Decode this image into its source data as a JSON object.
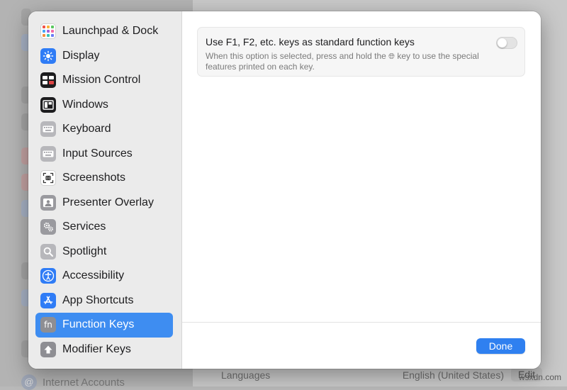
{
  "background": {
    "languages_label": "Languages",
    "languages_value": "English (United States)",
    "edit_label": "Edit",
    "internet_accounts_label": "Internet Accounts"
  },
  "sidebar": {
    "items": [
      {
        "label": "Launchpad & Dock",
        "icon": "launchpad-icon"
      },
      {
        "label": "Display",
        "icon": "display-brightness-icon"
      },
      {
        "label": "Mission Control",
        "icon": "mission-control-icon"
      },
      {
        "label": "Windows",
        "icon": "windows-icon"
      },
      {
        "label": "Keyboard",
        "icon": "keyboard-icon"
      },
      {
        "label": "Input Sources",
        "icon": "input-sources-icon"
      },
      {
        "label": "Screenshots",
        "icon": "screenshot-icon"
      },
      {
        "label": "Presenter Overlay",
        "icon": "presenter-overlay-icon"
      },
      {
        "label": "Services",
        "icon": "gears-icon"
      },
      {
        "label": "Spotlight",
        "icon": "magnifier-icon"
      },
      {
        "label": "Accessibility",
        "icon": "accessibility-icon"
      },
      {
        "label": "App Shortcuts",
        "icon": "app-store-icon"
      },
      {
        "label": "Function Keys",
        "icon": "fn-key-icon",
        "selected": true
      },
      {
        "label": "Modifier Keys",
        "icon": "modifier-key-icon"
      }
    ]
  },
  "main": {
    "option": {
      "title": "Use F1, F2, etc. keys as standard function keys",
      "desc_part1": "When this option is selected, press and hold the",
      "desc_part2": "key to use the special features printed on each key.",
      "enabled": false
    },
    "done_label": "Done"
  },
  "colors": {
    "accent": "#3e8df1",
    "done_button": "#2f80f0"
  },
  "watermark": "wsxdn.com"
}
